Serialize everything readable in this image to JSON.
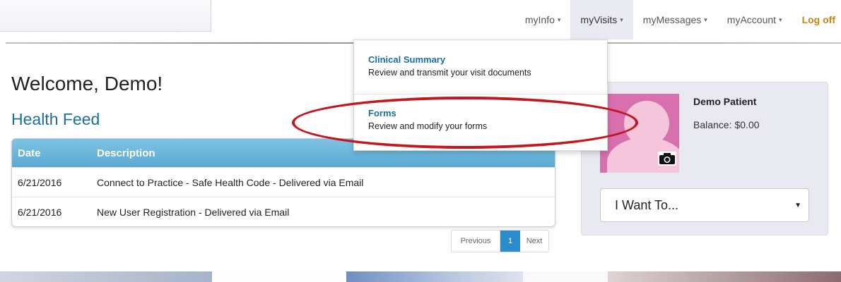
{
  "nav": {
    "items": [
      {
        "label": "myInfo",
        "caret": "▾"
      },
      {
        "label": "myVisits",
        "caret": "▾"
      },
      {
        "label": "myMessages",
        "caret": "▾"
      },
      {
        "label": "myAccount",
        "caret": "▾"
      }
    ],
    "logoff": "Log off"
  },
  "dropdown": {
    "items": [
      {
        "title": "Clinical Summary",
        "desc": "Review and transmit your visit documents"
      },
      {
        "title": "Forms",
        "desc": "Review and modify your forms"
      }
    ]
  },
  "welcome": "Welcome, Demo!",
  "feed": {
    "title": "Health Feed",
    "columns": [
      "Date",
      "Description"
    ],
    "rows": [
      {
        "date": "6/21/2016",
        "desc": "Connect to Practice - Safe Health Code - Delivered via Email"
      },
      {
        "date": "6/21/2016",
        "desc": "New User Registration - Delivered via Email"
      }
    ]
  },
  "pager": {
    "prev": "Previous",
    "page": "1",
    "next": "Next"
  },
  "profile": {
    "name": "Demo Patient",
    "balance_label": "Balance:",
    "balance_value": "$0.00",
    "select_value": "I Want To..."
  },
  "icons": {
    "camera": "camera-icon",
    "caret": "chevron-down-icon"
  },
  "colors": {
    "accent": "#1e6e9a",
    "logoff": "#c8860b",
    "highlight": "#c3171f",
    "table_header": "#5aa9d3"
  }
}
